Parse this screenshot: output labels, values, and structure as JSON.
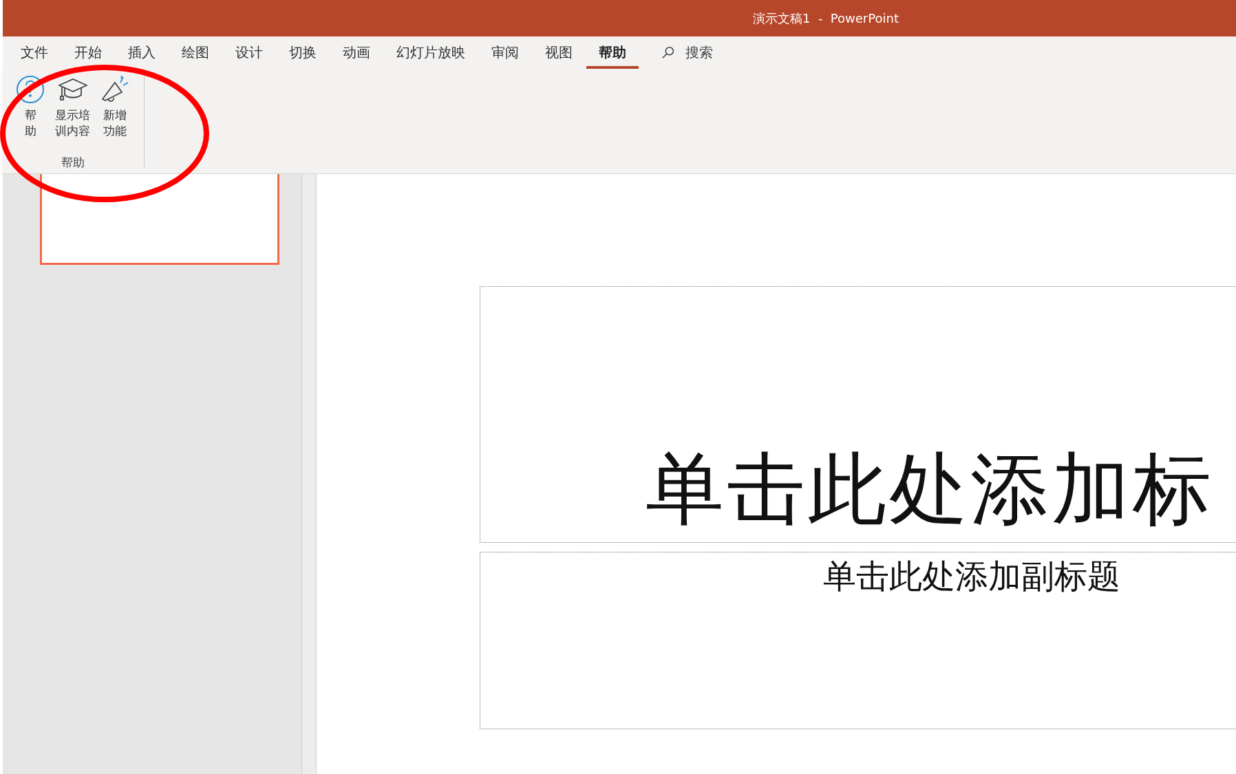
{
  "window": {
    "title": "演示文稿1  -  PowerPoint"
  },
  "tabs": [
    {
      "label": "文件",
      "selected": false
    },
    {
      "label": "开始",
      "selected": false
    },
    {
      "label": "插入",
      "selected": false
    },
    {
      "label": "绘图",
      "selected": false
    },
    {
      "label": "设计",
      "selected": false
    },
    {
      "label": "切换",
      "selected": false
    },
    {
      "label": "动画",
      "selected": false
    },
    {
      "label": "幻灯片放映",
      "selected": false
    },
    {
      "label": "审阅",
      "selected": false
    },
    {
      "label": "视图",
      "selected": false
    },
    {
      "label": "帮助",
      "selected": true
    }
  ],
  "search": {
    "label": "搜索"
  },
  "ribbon": {
    "groups": [
      {
        "label": "帮助",
        "buttons": [
          {
            "kind": "help",
            "lines": [
              "帮",
              "助"
            ]
          },
          {
            "kind": "training",
            "lines": [
              "显示培",
              "训内容"
            ]
          },
          {
            "kind": "whats-new",
            "lines": [
              "新增",
              "功能"
            ]
          }
        ]
      }
    ]
  },
  "slides_panel": {
    "thumbnails": [
      {
        "selected": true
      }
    ]
  },
  "slide": {
    "title_placeholder": "单击此处添加标",
    "subtitle_placeholder": "单击此处添加副标题"
  }
}
